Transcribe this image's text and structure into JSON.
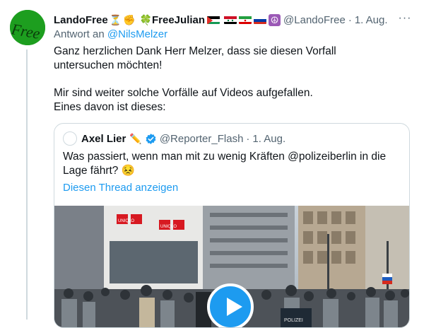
{
  "tweet": {
    "author_name": "LandoFree",
    "name_emoji_1": "⏳",
    "name_emoji_2": "✊",
    "name_emoji_3": "🍀",
    "author_name_2": "FreeJulian",
    "name_emoji_4": "☮",
    "handle": "@LandoFree",
    "date": "1. Aug.",
    "separator": "·",
    "more_label": "···",
    "avatar_text": "Free",
    "reply_prefix": "Antwort an",
    "reply_to": "@NilsMelzer",
    "text_line_1": "Ganz herzlichen Dank Herr Melzer, dass sie diesen Vorfall untersuchen möchten!",
    "text_line_2": "Mir sind weiter solche Vorfälle auf Videos aufgefallen.",
    "text_line_3": "Eines davon ist dieses:"
  },
  "quote": {
    "author_name": "Axel Lier",
    "name_emoji": "✏️",
    "handle": "@Reporter_Flash",
    "date": "1. Aug.",
    "separator": "·",
    "text": "Was passiert, wenn man mit zu wenig Kräften @polizeiberlin in die Lage fährt?",
    "text_emoji": "😣",
    "show_thread": "Diesen Thread anzeigen",
    "store_sign": "UNIQLO",
    "police_text": "POLIZEI"
  },
  "colors": {
    "link": "#1d9bf0",
    "secondary_text": "#536471",
    "border": "#cfd9de",
    "avatar_bg": "#1d9e1f"
  },
  "icons": [
    "more-icon",
    "verified-icon",
    "play-icon"
  ]
}
